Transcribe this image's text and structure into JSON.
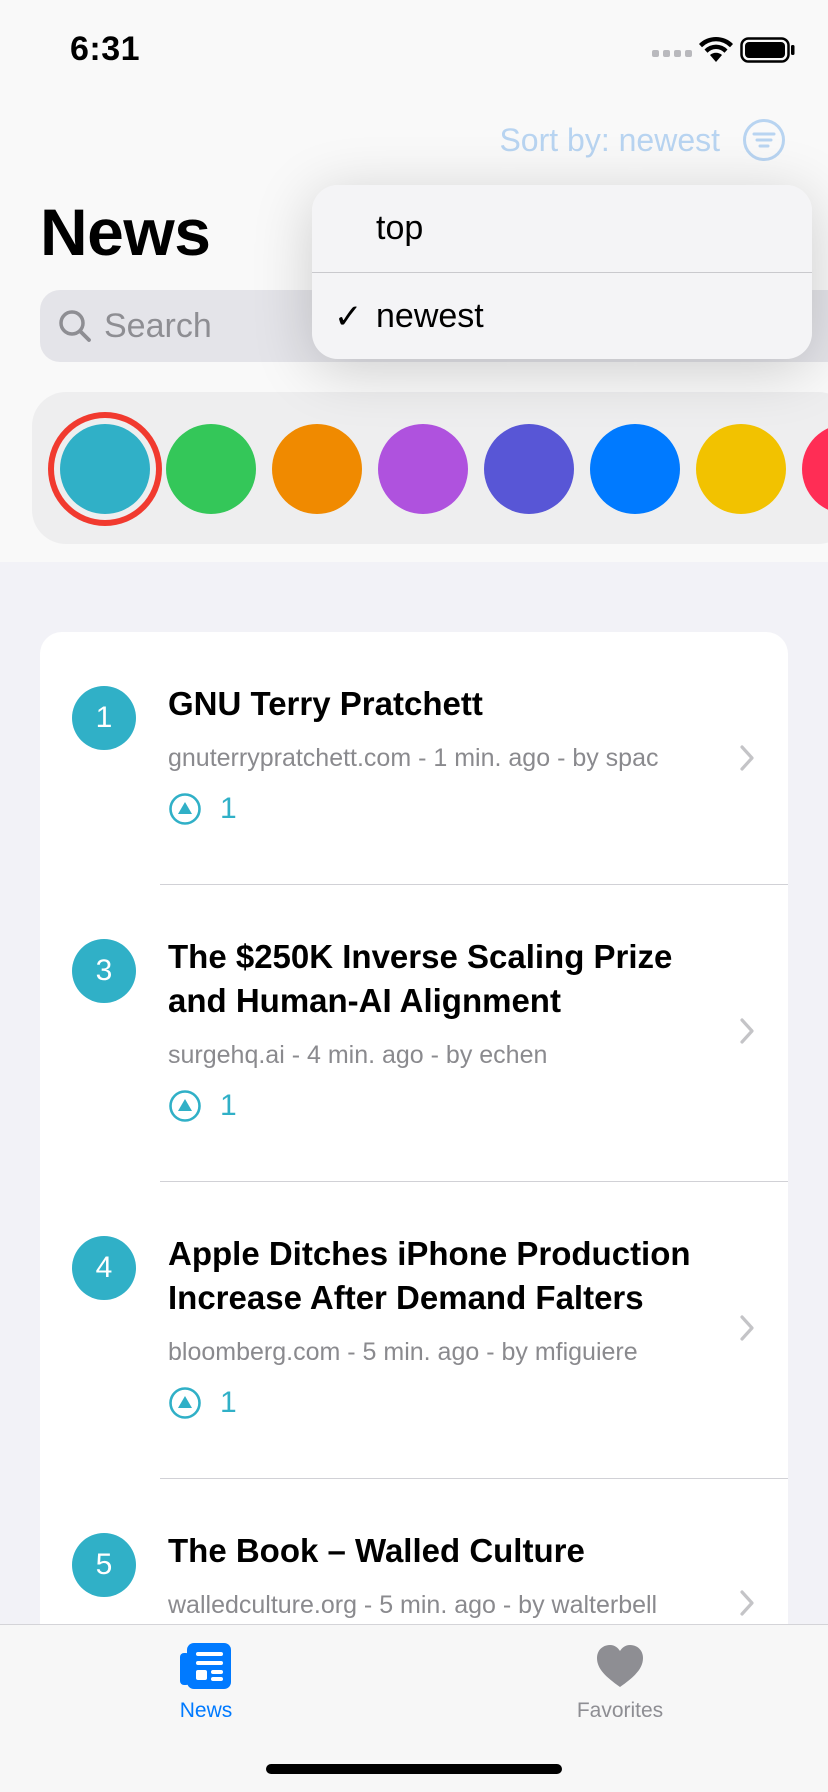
{
  "status_bar": {
    "time": "6:31"
  },
  "header": {
    "title": "News",
    "sort_label": "Sort by: newest",
    "search_placeholder": "Search"
  },
  "sort_menu": {
    "items": [
      {
        "label": "top",
        "checked": false
      },
      {
        "label": "newest",
        "checked": true
      }
    ],
    "check_glyph": "✓"
  },
  "color_palette": {
    "selected_index": 0,
    "colors": [
      "#30b0c7",
      "#34c759",
      "#f08a00",
      "#af52de",
      "#5856d6",
      "#007aff",
      "#f2c200",
      "#ff2d55"
    ]
  },
  "stories": [
    {
      "rank": "1",
      "title": "GNU Terry Pratchett",
      "meta": "gnuterrypratchett.com - 1 min. ago - by spac",
      "score": "1"
    },
    {
      "rank": "3",
      "title": "The $250K Inverse Scaling Prize and Human-AI Alignment",
      "meta": "surgehq.ai - 4 min. ago - by echen",
      "score": "1"
    },
    {
      "rank": "4",
      "title": "Apple Ditches iPhone Production Increase After Demand Falters",
      "meta": "bloomberg.com - 5 min. ago - by mfiguiere",
      "score": "1"
    },
    {
      "rank": "5",
      "title": "The Book – Walled Culture",
      "meta": "walledculture.org - 5 min. ago - by walterbell",
      "score": ""
    }
  ],
  "tab_bar": {
    "tabs": [
      {
        "label": "News",
        "icon": "newspaper-icon",
        "active": true
      },
      {
        "label": "Favorites",
        "icon": "heart-icon",
        "active": false
      }
    ]
  },
  "colors": {
    "accent": "#30b0c7",
    "active_tab": "#007aff",
    "inactive_tab": "#8e8e93"
  }
}
